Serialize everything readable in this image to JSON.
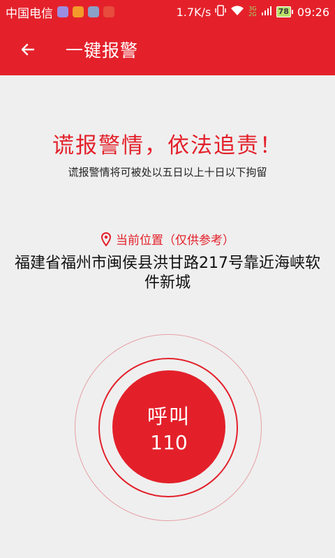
{
  "status_bar": {
    "carrier": "中国电信",
    "speed": "1.7K/s",
    "network": "3G",
    "network2": "2G",
    "battery": "78",
    "time": "09:26",
    "colors": {
      "bar": "#e4212b",
      "app1": "#9b8de0",
      "app2": "#f39a2a",
      "app3": "#8aa0c6",
      "app4": "#e74c3c"
    }
  },
  "app_bar": {
    "title": "一键报警",
    "back_icon": "arrow-left-icon"
  },
  "warning": {
    "title": "谎报警情，依法追责！",
    "subtitle": "谎报警情将可被处以五日以上十日以下拘留"
  },
  "location": {
    "label": "当前位置（仅供参考）",
    "icon": "location-pin-icon",
    "address": "福建省福州市闽侯县洪甘路217号靠近海峡软件新城"
  },
  "call": {
    "label": "呼叫",
    "number": "110"
  },
  "theme": {
    "accent": "#e3202a",
    "background": "#efefef"
  }
}
